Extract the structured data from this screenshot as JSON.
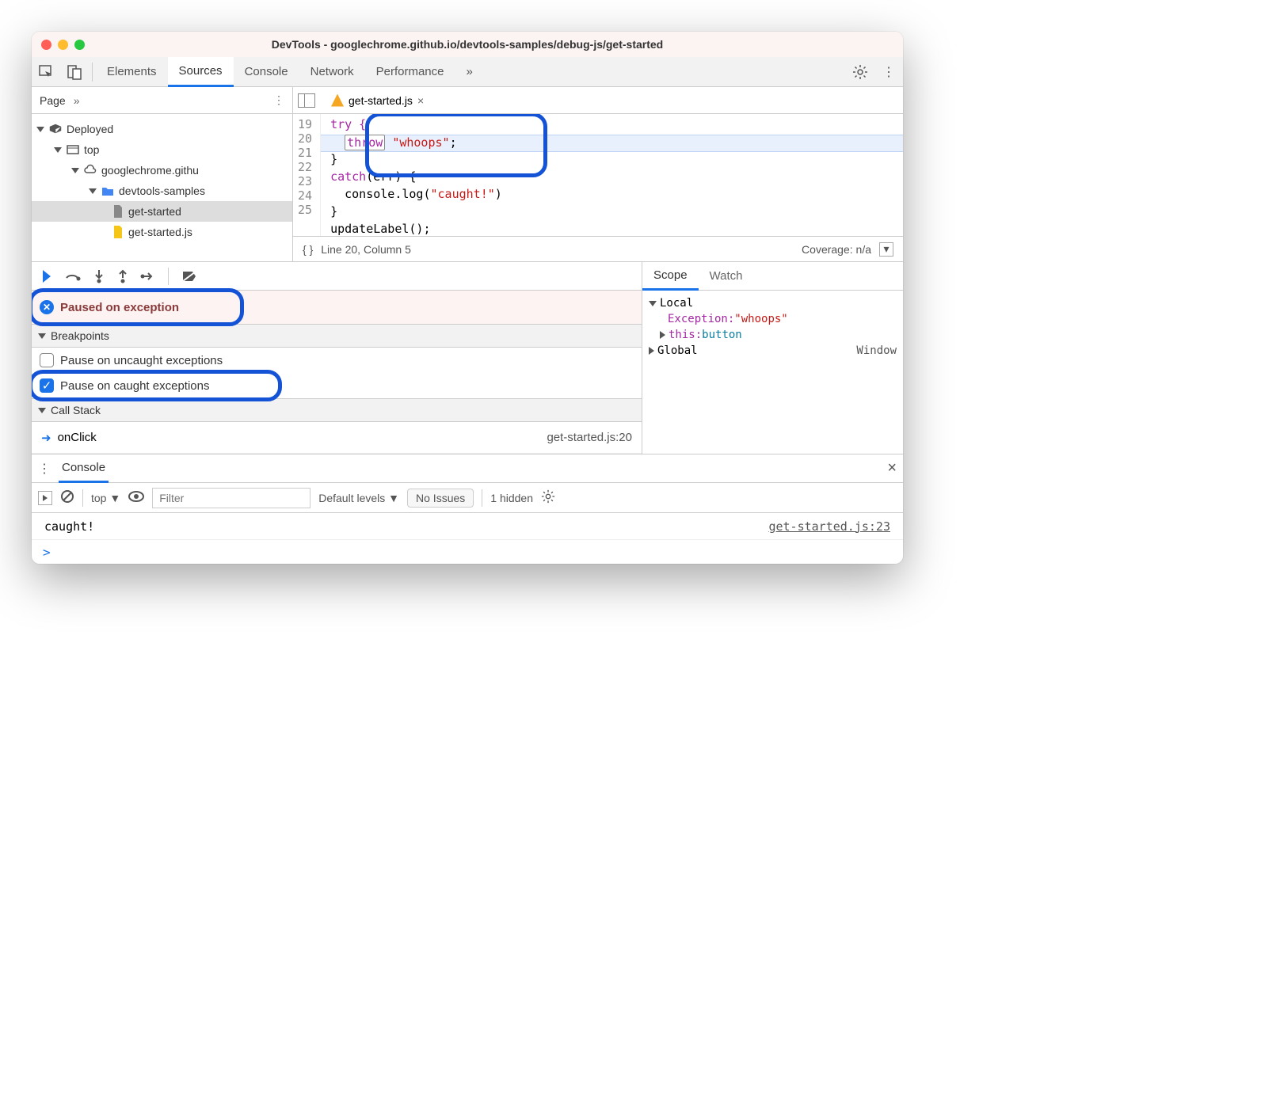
{
  "window_title": "DevTools - googlechrome.github.io/devtools-samples/debug-js/get-started",
  "tabs": {
    "t0": "Elements",
    "t1": "Sources",
    "t2": "Console",
    "t3": "Network",
    "t4": "Performance"
  },
  "nav": {
    "page": "Page",
    "deployed": "Deployed",
    "top": "top",
    "domain": "googlechrome.githu",
    "folder": "devtools-samples",
    "file1": "get-started",
    "file2": "get-started.js"
  },
  "filetab": "get-started.js",
  "code": {
    "l19": "try {",
    "l20_throw": "throw",
    "l20_str": "\"whoops\"",
    "l20_semi": ";",
    "l21": "}",
    "l22a": "catch",
    "l22b": "(err) {",
    "l23a": "console.log(",
    "l23b": "\"caught!\"",
    "l23c": ")",
    "l24": "}",
    "l25": "updateLabel();"
  },
  "gutter": {
    "l19": "19",
    "l20": "20",
    "l21": "21",
    "l22": "22",
    "l23": "23",
    "l24": "24",
    "l25": "25"
  },
  "status": {
    "braces": "{ }",
    "pos": "Line 20, Column 5",
    "coverage": "Coverage: n/a"
  },
  "paused": "Paused on exception",
  "sections": {
    "breakpoints": "Breakpoints",
    "callstack": "Call Stack"
  },
  "checks": {
    "uncaught": "Pause on uncaught exceptions",
    "caught": "Pause on caught exceptions"
  },
  "stack": {
    "fn": "onClick",
    "loc": "get-started.js:20"
  },
  "scopetabs": {
    "scope": "Scope",
    "watch": "Watch"
  },
  "scope": {
    "local": "Local",
    "exception": "Exception: ",
    "excval": "\"whoops\"",
    "thisk": "this: ",
    "thisv": "button",
    "global": "Global",
    "globalv": "Window"
  },
  "drawer": {
    "tab": "Console"
  },
  "consolebar": {
    "context": "top",
    "filter_ph": "Filter",
    "levels": "Default levels",
    "issues": "No Issues",
    "hidden": "1 hidden"
  },
  "log": {
    "msg": "caught!",
    "loc": "get-started.js:23"
  },
  "prompt": ">"
}
